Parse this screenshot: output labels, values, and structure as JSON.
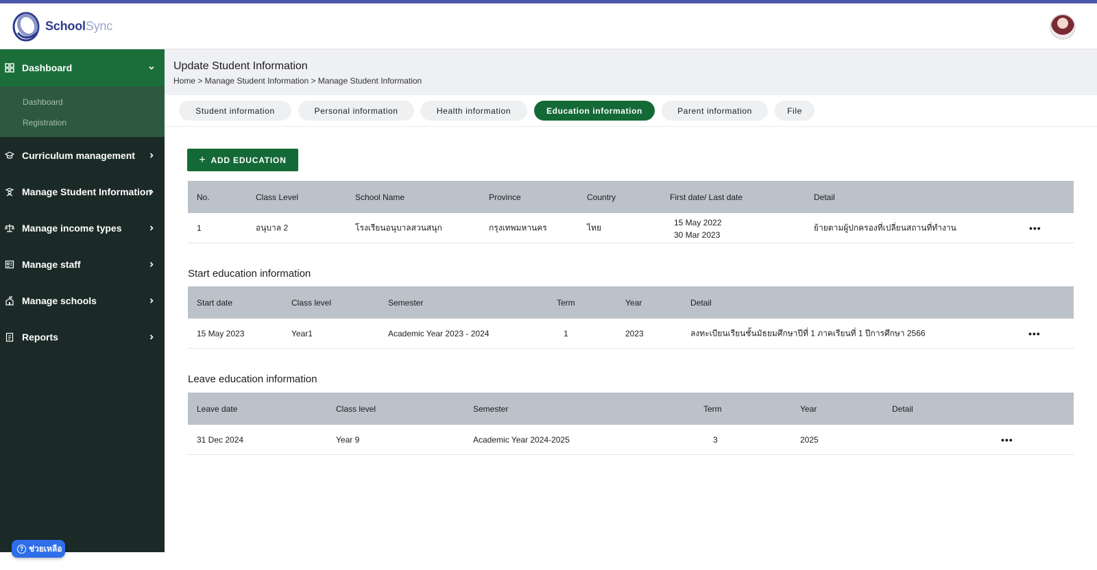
{
  "brand": {
    "name_a": "School",
    "name_b": "Sync"
  },
  "sidebar": {
    "head": {
      "label": "Dashboard",
      "icon": "grid-icon"
    },
    "sub_items": [
      "Dashboard",
      "Registration"
    ],
    "items": [
      {
        "label": "Curriculum management",
        "icon": "graduation-cap-icon"
      },
      {
        "label": "Manage Student Information",
        "icon": "student-icon"
      },
      {
        "label": "Manage income types",
        "icon": "scale-icon"
      },
      {
        "label": "Manage staff",
        "icon": "staff-badge-icon"
      },
      {
        "label": "Manage schools",
        "icon": "school-icon"
      },
      {
        "label": "Reports",
        "icon": "report-icon"
      }
    ]
  },
  "help": {
    "label": "ช่วยเหลือ"
  },
  "header": {
    "title": "Update Student Information",
    "breadcrumb": "Home > Manage Student Information > Manage Student Information"
  },
  "tabs": [
    "Student information",
    "Personal information",
    "Health information",
    "Education information",
    "Parent information",
    "File"
  ],
  "active_tab": "Education information",
  "add_button": "ADD EDUCATION",
  "education_table": {
    "headers": [
      "No.",
      "Class Level",
      "School Name",
      "Province",
      "Country",
      "First date/ Last date",
      "Detail"
    ],
    "rows": [
      {
        "no": "1",
        "class_level": "อนุบาล 2",
        "school": "โรงเรียนอนุบาลสวนสนุก",
        "province": "กรุงเทพมหานคร",
        "country": "ไทย",
        "first_date": "15 May 2022",
        "last_date": "30 Mar 2023",
        "detail": "ย้ายตามผู้ปกครองที่เปลี่ยนสถานที่ทำงาน"
      }
    ]
  },
  "start_section": {
    "title": "Start education information",
    "headers": [
      "Start date",
      "Class level",
      "Semester",
      "Term",
      "Year",
      "Detail"
    ],
    "rows": [
      {
        "date": "15 May 2023",
        "class_level": "Year1",
        "semester": "Academic Year 2023 - 2024",
        "term": "1",
        "year": "2023",
        "detail": "ลงทะเบียนเรียนชั้นมัธยมศึกษาปีที่ 1 ภาคเรียนที่ 1 ปีการศึกษา 2566"
      }
    ]
  },
  "leave_section": {
    "title": "Leave education information",
    "headers": [
      "Leave date",
      "Class level",
      "Semester",
      "Term",
      "Year",
      "Detail"
    ],
    "rows": [
      {
        "date": "31 Dec 2024",
        "class_level": "Year 9",
        "semester": "Academic Year 2024-2025",
        "term": "3",
        "year": "2025",
        "detail": ""
      }
    ]
  },
  "colors": {
    "primary_green": "#146a36",
    "sidebar_bg": "#1b2a27",
    "table_header": "#bcc2ca",
    "accent_blue": "#4b57a8"
  }
}
